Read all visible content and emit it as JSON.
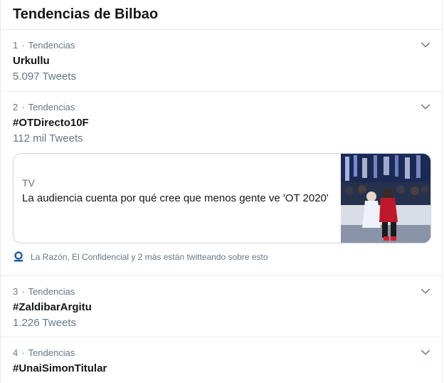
{
  "header": {
    "title": "Tendencias de Bilbao"
  },
  "trends": [
    {
      "rank": "1",
      "context": "Tendencias",
      "name": "Urkullu",
      "count": "5.097 Tweets"
    },
    {
      "rank": "2",
      "context": "Tendencias",
      "name": "#OTDirecto10F",
      "count": "112 mil Tweets",
      "card": {
        "category": "TV",
        "headline": "La audiencia cuenta por qué cree que menos gente ve 'OT 2020'"
      },
      "social_context": "La Razón, El Confidencial y 2 más están twitteando sobre esto"
    },
    {
      "rank": "3",
      "context": "Tendencias",
      "name": "#ZaldibarArgitu",
      "count": "1.226 Tweets"
    },
    {
      "rank": "4",
      "context": "Tendencias",
      "name": "#UnaiSimonTitular"
    }
  ],
  "icons": {
    "more": "chevron-down-icon",
    "source": "news-source-icon"
  },
  "colors": {
    "text": "#14171a",
    "secondary": "#657786",
    "border": "#e6ecf0",
    "accent": "#1da1f2"
  }
}
